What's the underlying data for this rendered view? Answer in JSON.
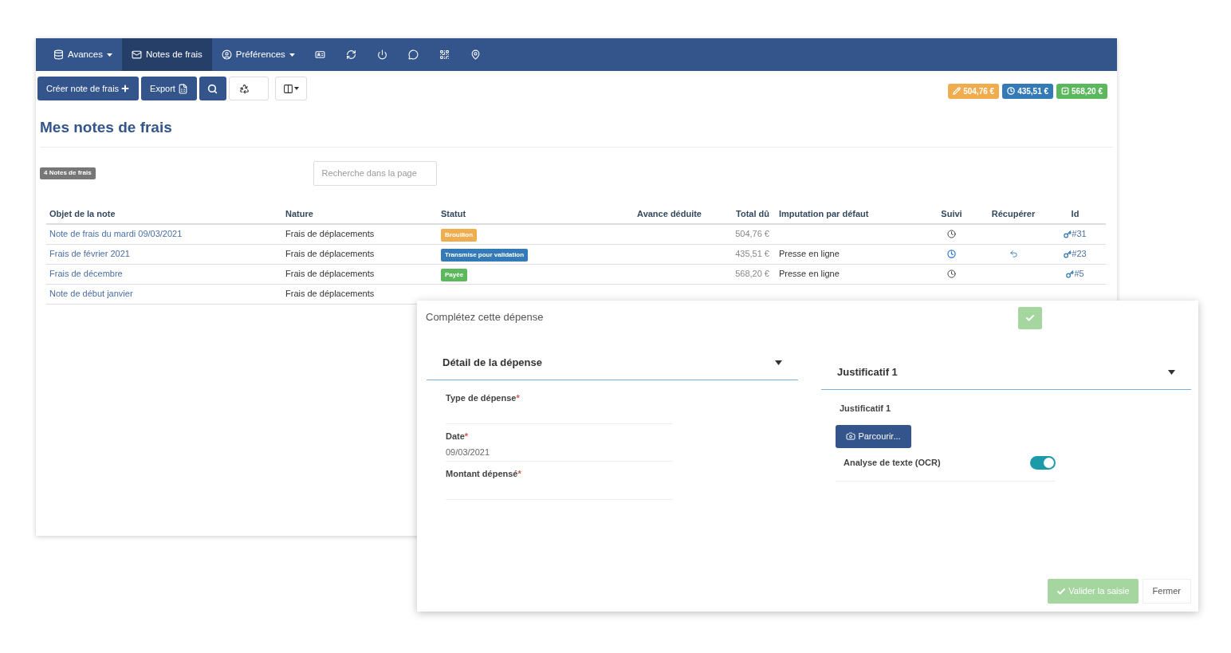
{
  "nav": {
    "items": [
      {
        "kind": "dropdown",
        "label": "Avances",
        "selected": false
      },
      {
        "kind": "link",
        "label": "Notes de frais",
        "selected": true
      },
      {
        "kind": "dropdown",
        "label": "Préférences",
        "selected": false
      },
      {
        "kind": "icon",
        "selected": false
      },
      {
        "kind": "icon",
        "selected": false
      },
      {
        "kind": "icon",
        "selected": false
      },
      {
        "kind": "icon",
        "selected": false
      },
      {
        "kind": "icon",
        "selected": false
      },
      {
        "kind": "icon",
        "selected": false
      }
    ]
  },
  "toolbar": {
    "create_button": "Créer note de frais",
    "export_button": "Export"
  },
  "totals": [
    {
      "text": "504,76 €",
      "color": "#f0ad4e"
    },
    {
      "text": "435,51 €",
      "color": "#337ab7"
    },
    {
      "text": "568,20 €",
      "color": "#5cb85c"
    }
  ],
  "page_title": "Mes notes de frais",
  "count_badge": "4 Notes de frais",
  "search": {
    "placeholder": "Recherche dans la page"
  },
  "table": {
    "columns": [
      "Objet de la note",
      "Nature",
      "Statut",
      "Avance déduite",
      "Total dû",
      "Imputation par défaut",
      "Suivi",
      "Récupérer",
      "Id"
    ],
    "rows": [
      {
        "object": "Note de frais du mardi 09/03/2021",
        "nature": "Frais de déplacements",
        "status": {
          "text": "Brouillon",
          "color": "#f0ad4e"
        },
        "total": "504,76 €",
        "tracking_active": false,
        "recoverable": false,
        "id": "#31"
      },
      {
        "object": "Frais de février 2021",
        "nature": "Frais de déplacements",
        "status": {
          "text": "Transmise pour validation",
          "color": "#337ab7"
        },
        "total": "435,51 €",
        "imputation": "Presse en ligne",
        "tracking_active": true,
        "recoverable": true,
        "id": "#23"
      },
      {
        "object": "Frais de décembre",
        "nature": "Frais de déplacements",
        "status": {
          "text": "Payée",
          "color": "#5cb85c"
        },
        "total": "568,20 €",
        "imputation": "Presse en ligne",
        "tracking_active": false,
        "recoverable": false,
        "id": "#5"
      },
      {
        "object": "Note de début janvier",
        "nature": "Frais de déplacements"
      }
    ]
  },
  "modal": {
    "title": "Complétez cette dépense",
    "confirm_disabled": true,
    "detail": {
      "title": "Détail de la dépense",
      "expanded": true,
      "required_mark": "*",
      "fields": [
        {
          "label": "Type de dépense",
          "required": true
        },
        {
          "label": "Date",
          "required": true,
          "value": "09/03/2021"
        },
        {
          "label": "Montant dépensé",
          "required": true
        }
      ]
    },
    "receipt": {
      "title": "Justificatif 1",
      "expanded": true,
      "label": "Justificatif 1",
      "browse_button": "Parcourir...",
      "ocr": {
        "label": "Analyse de texte (OCR)",
        "on": true
      }
    },
    "footer": {
      "validate_button": "Valider la saisie",
      "validate_disabled": true,
      "close_button": "Fermer"
    }
  }
}
